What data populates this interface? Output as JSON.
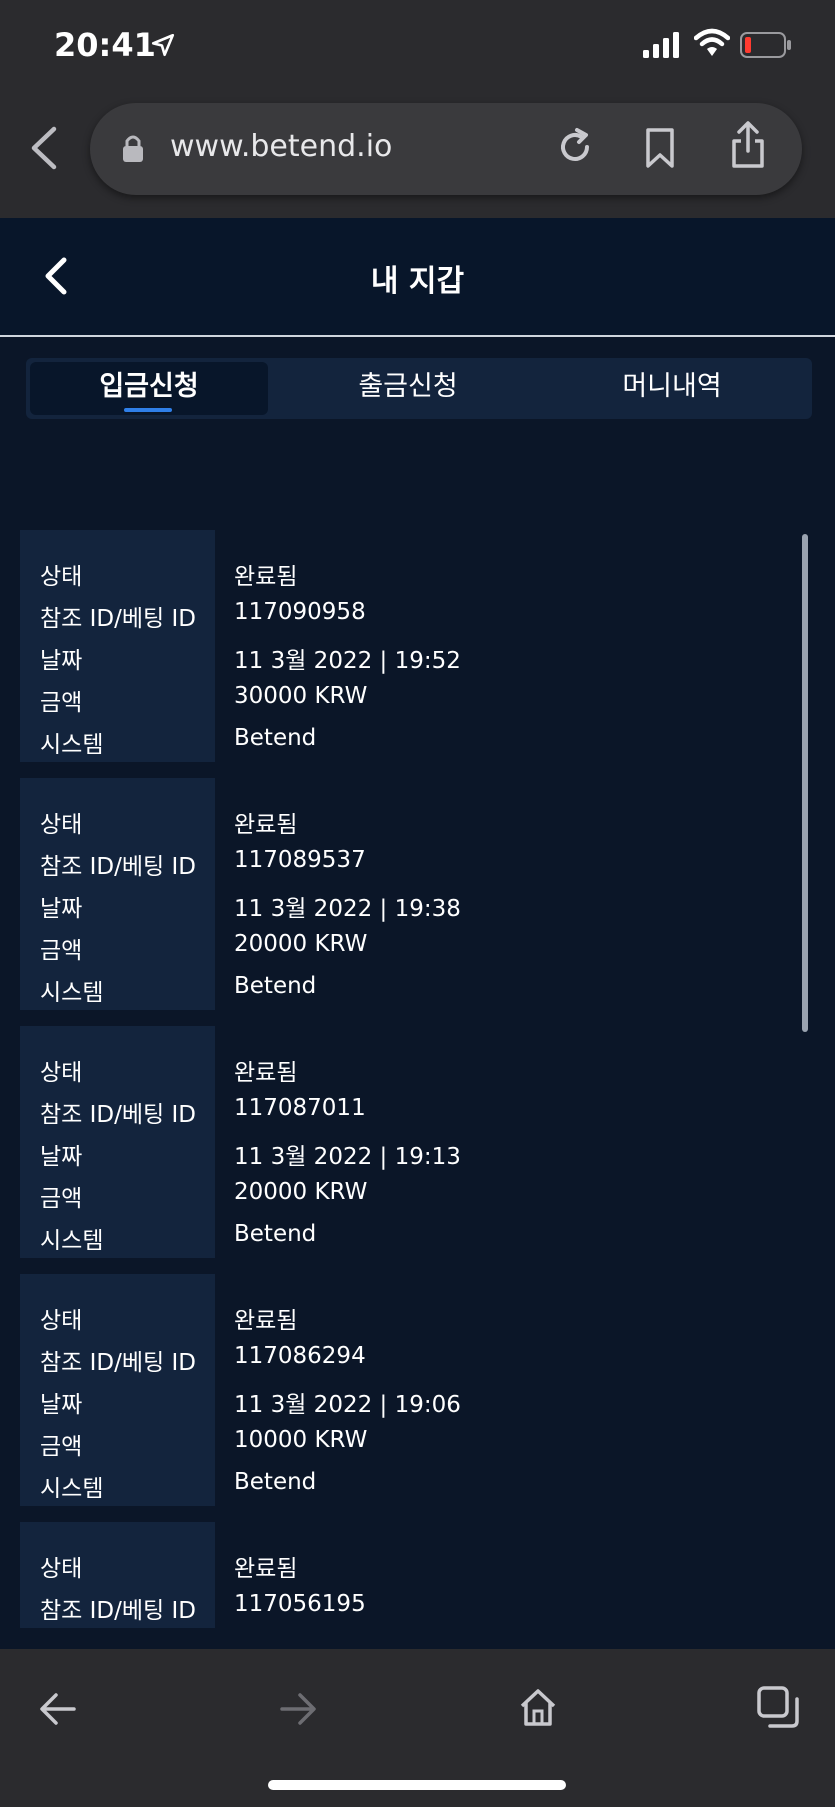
{
  "status_bar": {
    "time": "20:41"
  },
  "browser": {
    "url": "www.betend.io"
  },
  "header": {
    "title": "내 지갑"
  },
  "tabs": [
    {
      "label": "입금신청",
      "active": true
    },
    {
      "label": "출금신청",
      "active": false
    },
    {
      "label": "머니내역",
      "active": false
    }
  ],
  "labels": {
    "status": "상태",
    "reference": "참조 ID/베팅 ID",
    "date": "날짜",
    "amount": "금액",
    "system": "시스템"
  },
  "transactions": [
    {
      "status": "완료됨",
      "reference": "117090958",
      "date": "11 3월 2022 | 19:52",
      "amount": "30000 KRW",
      "system": "Betend"
    },
    {
      "status": "완료됨",
      "reference": "117089537",
      "date": "11 3월 2022 | 19:38",
      "amount": "20000 KRW",
      "system": "Betend"
    },
    {
      "status": "완료됨",
      "reference": "117087011",
      "date": "11 3월 2022 | 19:13",
      "amount": "20000 KRW",
      "system": "Betend"
    },
    {
      "status": "완료됨",
      "reference": "117086294",
      "date": "11 3월 2022 | 19:06",
      "amount": "10000 KRW",
      "system": "Betend"
    },
    {
      "status": "완료됨",
      "reference": "117056195"
    }
  ],
  "colors": {
    "background": "#0b1628",
    "card_label_bg": "#13243d",
    "accent": "#2f7fe8",
    "browser_chrome": "#2b2b2e"
  },
  "icons": [
    "location-arrow-icon",
    "signal-icon",
    "wifi-icon",
    "battery-icon",
    "chevron-left-icon",
    "lock-icon",
    "reload-icon",
    "bookmark-icon",
    "share-icon",
    "back-arrow-icon",
    "forward-arrow-icon",
    "home-icon",
    "tabs-icon"
  ]
}
